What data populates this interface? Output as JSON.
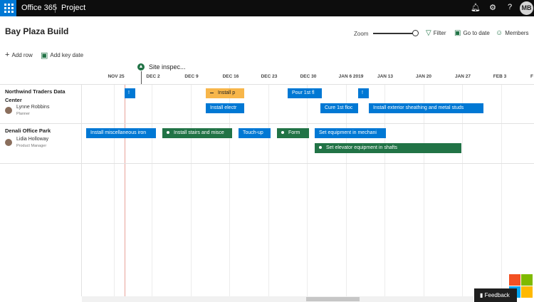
{
  "topbar": {
    "suite": "Office 365",
    "app": "Project",
    "icons": [
      "bell-icon",
      "gear-icon",
      "help-icon"
    ],
    "avatar_initials": "MB"
  },
  "plan": {
    "title": "Bay Plaza Build"
  },
  "header_actions": {
    "zoom_label": "Zoom",
    "zoom_level": 1.0,
    "filter_label": "Filter",
    "goto_label": "Go to date",
    "members_label": "Members"
  },
  "toolbar": {
    "add_row": "Add row",
    "add_key_date": "Add key date"
  },
  "milestone": {
    "label": "Site inspec..."
  },
  "timeline": {
    "dates": [
      "NOV 25",
      "DEC 2",
      "DEC 9",
      "DEC 16",
      "DEC 23",
      "DEC 30",
      "JAN 6 2019",
      "JAN 13",
      "JAN 20",
      "JAN 27",
      "FEB 3",
      "F"
    ]
  },
  "rows": [
    {
      "title": "Northwind Traders Data Center",
      "person": "Lynne Robbins",
      "role": "Planner",
      "tasks": [
        {
          "label": "!",
          "color": "blue"
        },
        {
          "label": "Install p",
          "color": "orange"
        },
        {
          "label": "Pour 1st fl",
          "color": "blue"
        },
        {
          "label": "!",
          "color": "blue"
        },
        {
          "label": "Install electr",
          "color": "blue"
        },
        {
          "label": "Cure 1st floc",
          "color": "blue"
        },
        {
          "label": "Install exterior sheathing and metal studs",
          "color": "blue"
        }
      ]
    },
    {
      "title": "Denali Office Park",
      "person": "Lidia Holloway",
      "role": "Product Manager",
      "tasks": [
        {
          "label": "Install miscellaneous iron",
          "color": "blue"
        },
        {
          "label": "Install stairs and misce",
          "color": "green"
        },
        {
          "label": "Touch-up",
          "color": "blue"
        },
        {
          "label": "Form",
          "color": "green"
        },
        {
          "label": "Set equipment in mechani",
          "color": "blue"
        },
        {
          "label": "Set elevator equipment in shafts",
          "color": "green"
        }
      ]
    }
  ],
  "feedback": {
    "label": "Feedback"
  },
  "colors": {
    "accent_blue": "#0078d4",
    "accent_green": "#217346",
    "accent_orange": "#f7b64a"
  }
}
